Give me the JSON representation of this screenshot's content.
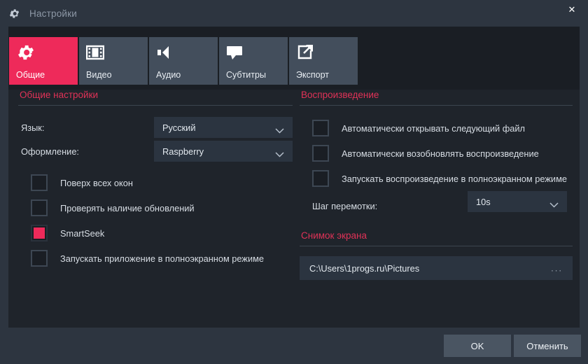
{
  "titlebar": {
    "icon": "gear-icon",
    "title": "Настройки",
    "close_label": "✕"
  },
  "tabs": [
    {
      "label": "Общие",
      "icon": "gear-icon",
      "active": true
    },
    {
      "label": "Видео",
      "icon": "film-icon",
      "active": false
    },
    {
      "label": "Аудио",
      "icon": "speaker-icon",
      "active": false
    },
    {
      "label": "Субтитры",
      "icon": "speech-bubble-icon",
      "active": false
    },
    {
      "label": "Экспорт",
      "icon": "export-arrow-icon",
      "active": false
    }
  ],
  "general": {
    "section_title": "Общие настройки",
    "language_label": "Язык:",
    "language_value": "Русский",
    "theme_label": "Оформление:",
    "theme_value": "Raspberry",
    "checkboxes": [
      {
        "label": "Поверх всех окон",
        "checked": false
      },
      {
        "label": "Проверять наличие обновлений",
        "checked": false
      },
      {
        "label": "SmartSeek",
        "checked": true
      },
      {
        "label": "Запускать приложение в полноэкранном режиме",
        "checked": false
      }
    ]
  },
  "playback": {
    "section_title": "Воспроизведение",
    "checkboxes": [
      {
        "label": "Автоматически открывать следующий файл",
        "checked": false
      },
      {
        "label": "Автоматически возобновлять воспроизведение",
        "checked": false
      },
      {
        "label": "Запускать воспроизведение в полноэкранном режиме",
        "checked": false
      }
    ],
    "seek_step_label": "Шаг перемотки:",
    "seek_step_value": "10s"
  },
  "screenshot": {
    "section_title": "Снимок экрана",
    "path_value": "C:\\Users\\1progs.ru\\Pictures",
    "browse_label": "..."
  },
  "footer": {
    "ok_label": "OK",
    "cancel_label": "Отменить"
  },
  "colors": {
    "accent": "#ee2a5a",
    "section_heading": "#e03257",
    "window_bg": "#2d3540",
    "panel_bg": "#1f242b",
    "tabstrip_bg": "#1a1e24",
    "tab_bg": "#434e5c",
    "field_bg": "#2b3440",
    "button_bg": "#4a5562"
  }
}
